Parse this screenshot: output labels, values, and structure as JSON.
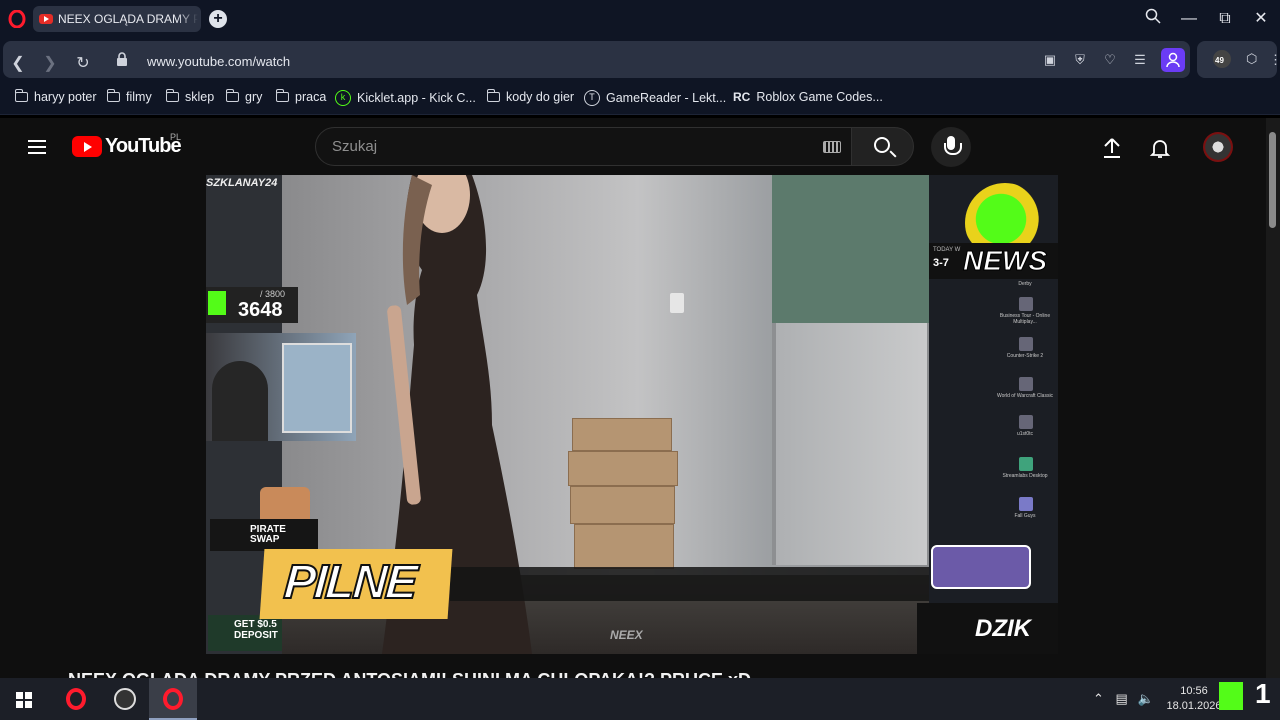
{
  "browser": {
    "tab_title": "NEEX OGLĄDA DRAMY PRZED ANTOSIAMI",
    "url": "www.youtube.com/watch",
    "extension_badge": "49",
    "bookmarks": [
      {
        "label": "haryy poter",
        "icon": "folder-icon"
      },
      {
        "label": "filmy",
        "icon": "folder-icon"
      },
      {
        "label": "sklep",
        "icon": "folder-icon"
      },
      {
        "label": "gry",
        "icon": "folder-icon"
      },
      {
        "label": "praca",
        "icon": "folder-icon"
      },
      {
        "label": "Kicklet.app - Kick C...",
        "icon": "kicklet-icon"
      },
      {
        "label": "kody do gier",
        "icon": "folder-icon"
      },
      {
        "label": "GameReader - Lekt...",
        "icon": "gamereader-icon"
      },
      {
        "label": "Roblox Game Codes...",
        "icon": "rc-icon"
      }
    ]
  },
  "youtube": {
    "logo_text": "YouTube",
    "region": "PL",
    "search_placeholder": "Szukaj",
    "video_title": "NEEX OGLĄDA DRAMY PRZED ANTOSIAMI! SHINI MA CHLOPAKA!? PRUCE xD"
  },
  "overlay": {
    "stream_name": "SZKLANAY24",
    "goal_current": "3648",
    "goal_total": "/ 3800",
    "news_label": "NEWS",
    "news_time": "3-7",
    "today_label": "TODAY W",
    "pilne": "PILNE",
    "pirate_swap": "PIRATE SWAP",
    "deposit": "GET $0.5 DEPOSIT",
    "dzik": "DZIK",
    "neex_watermark": "NEEX",
    "desktop_icons": [
      "Derby",
      "Business Tour - Online Multiplay...",
      "Counter-Strike 2",
      "World of Warcraft Classic",
      "u1st0tc",
      "Streamlabs Desktop",
      "Fall Guys"
    ]
  },
  "taskbar": {
    "time": "10:56",
    "date": "18.01.2026",
    "k1_label": "1"
  },
  "colors": {
    "browser_bg": "#0f1524",
    "youtube_red": "#ff0000",
    "opera_red": "#ff1b2d",
    "kick_green": "#53fc18",
    "pilne_yellow": "#f2c14e"
  }
}
